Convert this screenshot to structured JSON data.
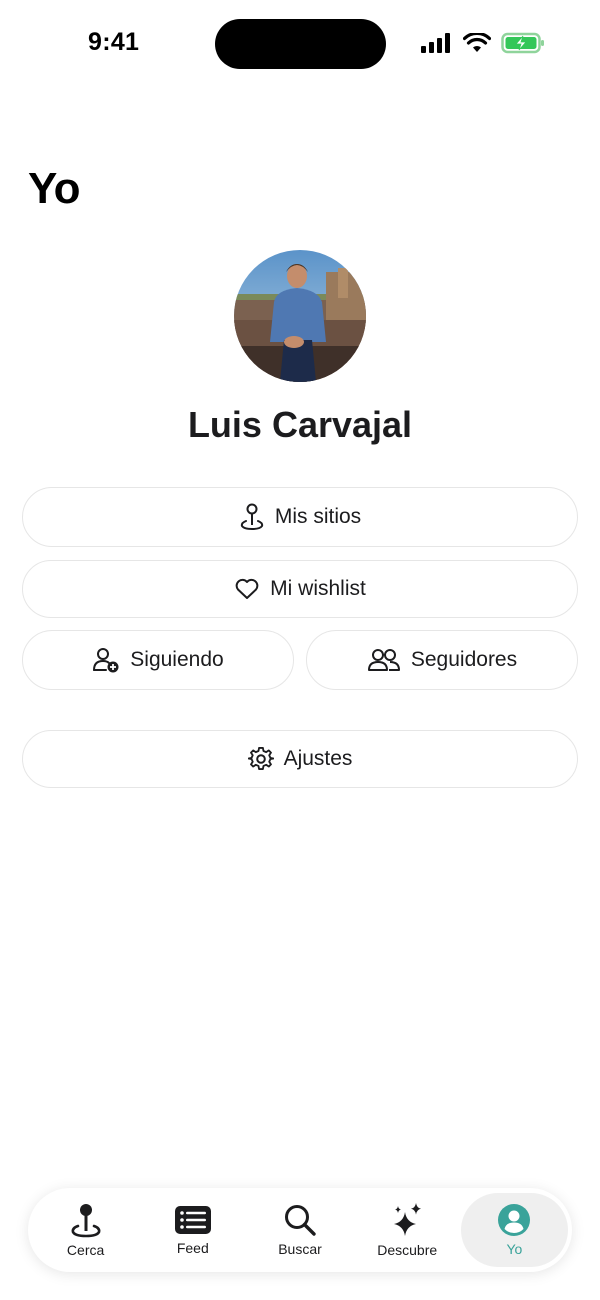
{
  "status_bar": {
    "time": "9:41"
  },
  "page": {
    "title": "Yo"
  },
  "profile": {
    "name": "Luis Carvajal"
  },
  "buttons": {
    "mis_sitios": "Mis sitios",
    "wishlist": "Mi wishlist",
    "siguiendo": "Siguiendo",
    "seguidores": "Seguidores",
    "ajustes": "Ajustes"
  },
  "tab_bar": {
    "items": [
      {
        "label": "Cerca",
        "icon": "pin-icon"
      },
      {
        "label": "Feed",
        "icon": "feed-icon"
      },
      {
        "label": "Buscar",
        "icon": "search-icon"
      },
      {
        "label": "Descubre",
        "icon": "sparkles-icon"
      },
      {
        "label": "Yo",
        "icon": "profile-icon",
        "active": true
      }
    ]
  },
  "colors": {
    "accent": "#3aa39a",
    "battery": "#34c759"
  }
}
